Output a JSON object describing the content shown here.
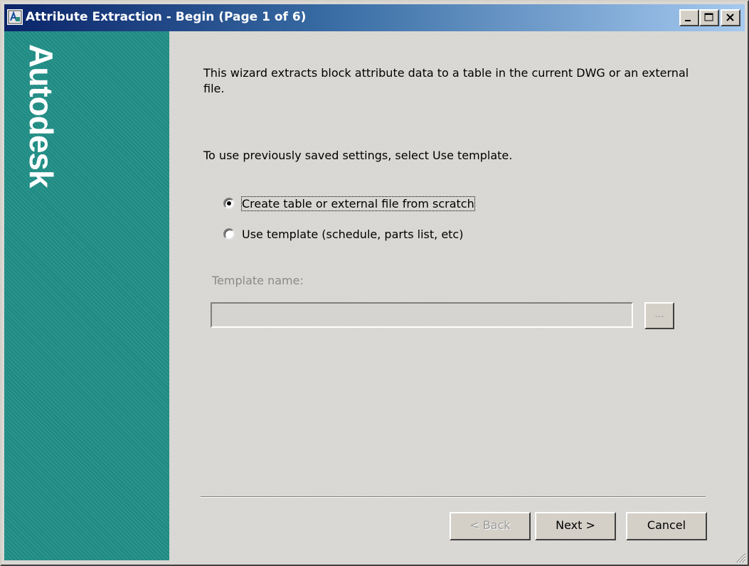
{
  "window": {
    "title": "Attribute Extraction - Begin (Page 1 of 6)"
  },
  "sidebar": {
    "brand": "Autodesk"
  },
  "content": {
    "description": "This wizard extracts block attribute data to a table in the current DWG or an external file.",
    "hint": "To use previously saved settings, select Use template.",
    "options": [
      {
        "label": "Create table or external file from scratch",
        "selected": true
      },
      {
        "label": "Use template (schedule, parts list, etc)",
        "selected": false
      }
    ],
    "template": {
      "label": "Template name:",
      "value": "",
      "browse_label": "..."
    }
  },
  "buttons": {
    "back": "< Back",
    "next": "Next >",
    "cancel": "Cancel"
  },
  "colors": {
    "sidebar": "#1f8c84",
    "titlebar_start": "#0a246a",
    "titlebar_end": "#a6caf0",
    "face": "#d4d0c8"
  }
}
